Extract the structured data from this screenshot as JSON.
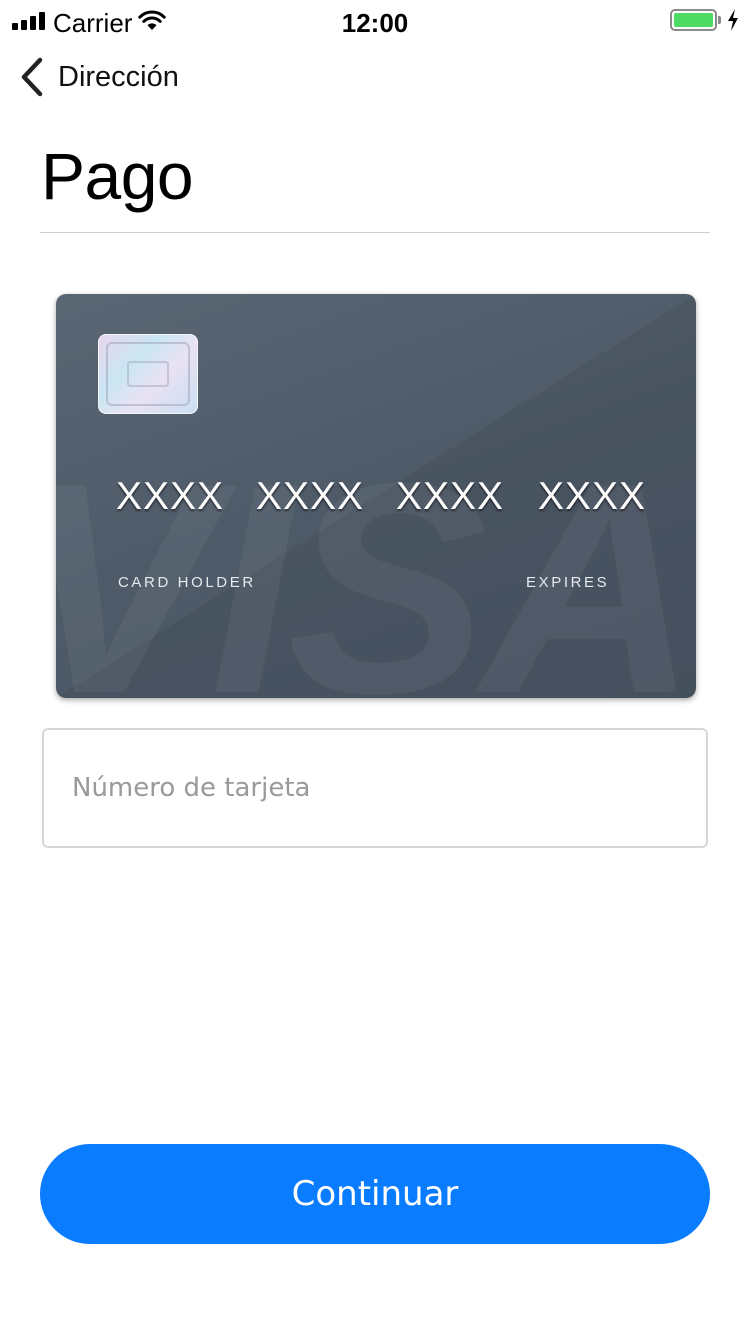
{
  "status_bar": {
    "carrier": "Carrier",
    "time": "12:00",
    "battery_level": 1.0,
    "battery_color": "#4cd964"
  },
  "nav": {
    "back_label": "Dirección",
    "back_icon": "chevron-left-icon"
  },
  "page": {
    "title": "Pago"
  },
  "card": {
    "number_groups": [
      "XXXX",
      "XXXX",
      "XXXX",
      "XXXX"
    ],
    "holder_label": "CARD HOLDER",
    "expires_label": "EXPIRES",
    "brand_watermark": "VISA",
    "background_color": "#4e5a68"
  },
  "form": {
    "card_number_placeholder": "Número de tarjeta",
    "card_number_value": ""
  },
  "actions": {
    "continue_label": "Continuar",
    "accent_color": "#0a7cff"
  }
}
